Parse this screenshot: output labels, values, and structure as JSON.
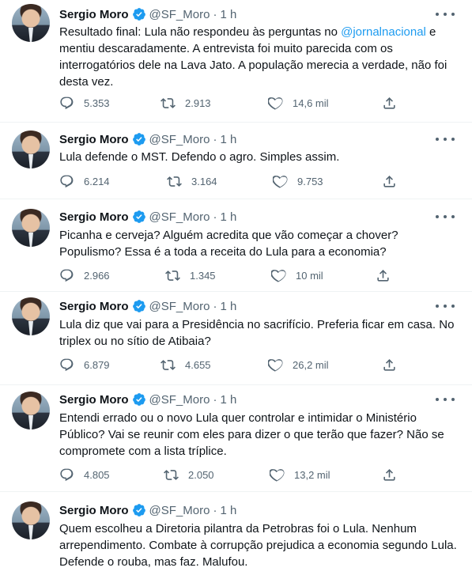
{
  "author": {
    "name": "Sergio Moro",
    "handle": "@SF_Moro",
    "separator": "·",
    "time": "1 h"
  },
  "colors": {
    "accent": "#1d9bf0",
    "muted": "#536471",
    "text": "#0f1419",
    "border": "#eff3f4"
  },
  "icons": {
    "verified": "verified-badge-icon",
    "more": "more-dots-icon",
    "reply": "reply-icon",
    "retweet": "retweet-icon",
    "like": "heart-icon",
    "share": "share-icon"
  },
  "tweets": [
    {
      "text_before": "Resultado final: Lula não respondeu às perguntas no ",
      "mention": "@jornalnacional",
      "text_after": " e mentiu descaradamente. A entrevista foi muito parecida com os interrogatórios dele na Lava Jato. A população merecia a verdade, não foi desta vez.",
      "replies": "5.353",
      "retweets": "2.913",
      "likes": "14,6 mil"
    },
    {
      "text_before": "Lula defende o MST. Defendo o agro. Simples assim.",
      "mention": "",
      "text_after": "",
      "replies": "6.214",
      "retweets": "3.164",
      "likes": "9.753"
    },
    {
      "text_before": "Picanha e cerveja?  Alguém acredita que vão começar a chover? Populismo? Essa é a toda a receita do Lula para a economia?",
      "mention": "",
      "text_after": "",
      "replies": "2.966",
      "retweets": "1.345",
      "likes": "10 mil"
    },
    {
      "text_before": "Lula diz que vai para a Presidência no sacrifício. Preferia ficar em casa. No triplex ou no sítio de Atibaia?",
      "mention": "",
      "text_after": "",
      "replies": "6.879",
      "retweets": "4.655",
      "likes": "26,2 mil"
    },
    {
      "text_before": "Entendi errado ou o novo Lula quer controlar e intimidar o Ministério Público? Vai se reunir com eles para dizer o que terão que fazer? Não se compromete com a lista tríplice.",
      "mention": "",
      "text_after": "",
      "replies": "4.805",
      "retweets": "2.050",
      "likes": "13,2 mil"
    },
    {
      "text_before": "Quem escolheu a Diretoria pilantra da Petrobras foi o Lula. Nenhum arrependimento. Combate à corrupção prejudica a economia segundo Lula. Defende o rouba, mas faz. Malufou.",
      "mention": "",
      "text_after": "",
      "replies": "",
      "retweets": "",
      "likes": ""
    }
  ]
}
